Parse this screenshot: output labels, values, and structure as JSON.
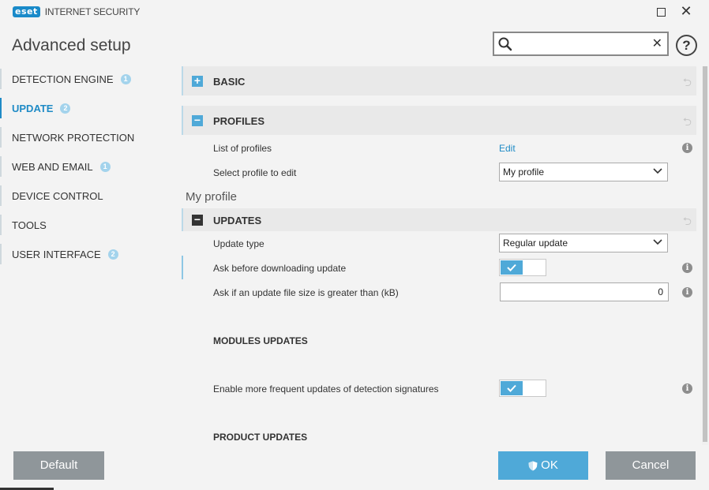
{
  "app": {
    "logo": "eset",
    "product": "INTERNET SECURITY",
    "title": "Advanced setup"
  },
  "search": {
    "value": "",
    "placeholder": ""
  },
  "icons": {
    "search": "search-icon",
    "clear": "close-icon",
    "help": "help-icon",
    "maximize": "maximize-icon",
    "close": "close-icon",
    "info": "info-icon",
    "revert": "revert-icon",
    "expand": "plus-icon",
    "collapse": "minus-icon",
    "check": "check-icon",
    "shield": "shield-icon"
  },
  "colors": {
    "accent": "#1f8bc6",
    "toggle_on": "#4fa9d8",
    "badge": "#a3d3ec",
    "button_gray": "#8f969a",
    "button_blue": "#4fa9d8"
  },
  "sidebar": {
    "items": [
      {
        "label": "DETECTION ENGINE",
        "badge": "1",
        "active": false
      },
      {
        "label": "UPDATE",
        "badge": "2",
        "active": true
      },
      {
        "label": "NETWORK PROTECTION",
        "badge": "",
        "active": false
      },
      {
        "label": "WEB AND EMAIL",
        "badge": "1",
        "active": false
      },
      {
        "label": "DEVICE CONTROL",
        "badge": "",
        "active": false
      },
      {
        "label": "TOOLS",
        "badge": "",
        "active": false
      },
      {
        "label": "USER INTERFACE",
        "badge": "2",
        "active": false
      }
    ]
  },
  "main": {
    "basic": {
      "title": "BASIC",
      "expanded": false
    },
    "profiles": {
      "title": "PROFILES",
      "expanded": true,
      "list_label": "List of profiles",
      "list_link": "Edit",
      "select_label": "Select profile to edit",
      "select_value": "My profile"
    },
    "profile_name": "My profile",
    "updates": {
      "title": "UPDATES",
      "expanded": true,
      "update_type_label": "Update type",
      "update_type_value": "Regular update",
      "ask_download_label": "Ask before downloading update",
      "ask_download_on": true,
      "ask_size_label": "Ask if an update file size is greater than (kB)",
      "ask_size_value": "0",
      "modules_title": "MODULES UPDATES",
      "frequent_label": "Enable more frequent updates of detection signatures",
      "frequent_on": true,
      "product_title": "PRODUCT UPDATES"
    }
  },
  "footer": {
    "default_label": "Default",
    "ok_label": "OK",
    "cancel_label": "Cancel"
  }
}
